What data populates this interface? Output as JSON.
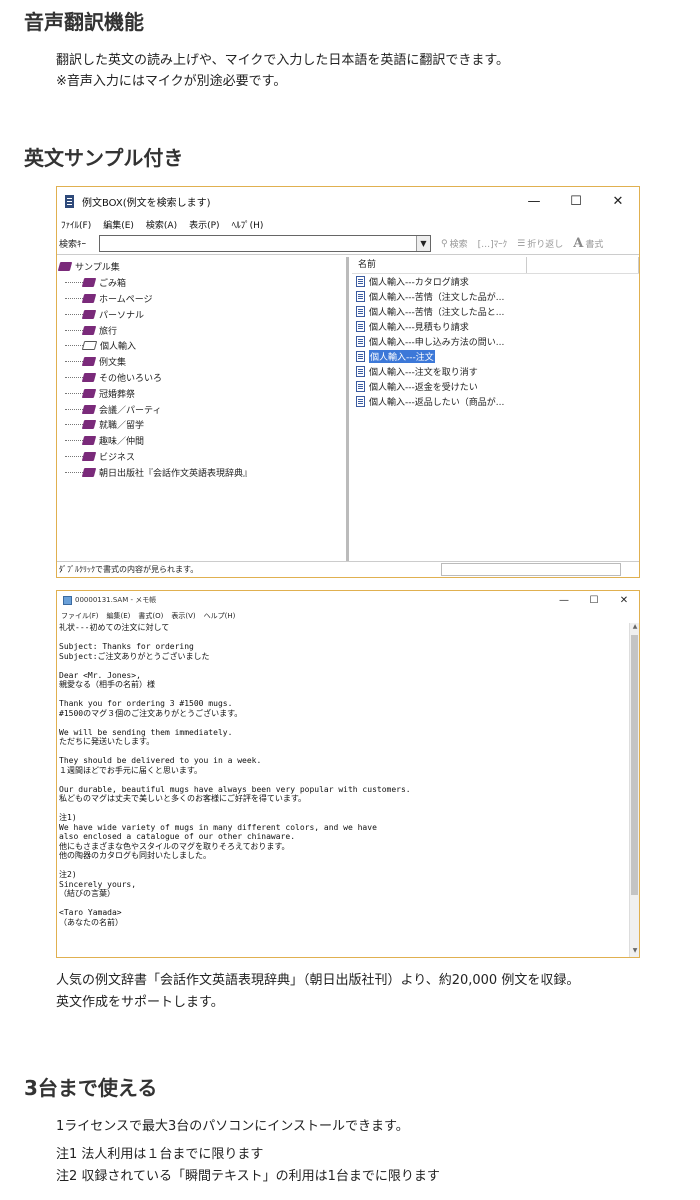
{
  "section1": {
    "heading": "音声翻訳機能",
    "line1": "翻訳した英文の読み上げや、マイクで入力した日本語を英語に翻訳できます。",
    "line2": "※音声入力にはマイクが別途必要です。"
  },
  "section2": {
    "heading": "英文サンプル付き",
    "caption1": "人気の例文辞書「会話作文英語表現辞典」（朝日出版社刊）より、約20,000 例文を収録。",
    "caption2": "英文作成をサポートします。"
  },
  "window1": {
    "title": "例文BOX(例文を検索します)",
    "controls": {
      "minimize": "—",
      "maximize": "☐",
      "close": "✕"
    },
    "menu": [
      "ﾌｧｲﾙ(F)",
      "編集(E)",
      "検索(A)",
      "表示(P)",
      "ﾍﾙﾌﾟ(H)"
    ],
    "search_label": "検索ｷｰ",
    "search_value": "",
    "toolbar": {
      "search": "検索",
      "mark": "[…]ﾏｰｸ",
      "wrap": "折り返し",
      "style": "書式",
      "style_glyph": "A"
    },
    "tree_root": "サンプル集",
    "tree_items": [
      "ごみ箱",
      "ホームページ",
      "パーソナル",
      "旅行",
      "個人輸入",
      "例文集",
      "その他いろいろ",
      "冠婚葬祭",
      "会議／パーティ",
      "就職／留学",
      "趣味／仲間",
      "ビジネス",
      "朝日出版社『会話作文英語表現辞典』"
    ],
    "list_header": "名前",
    "list_items": [
      "個人輸入---カタログ請求",
      "個人輸入---苦情（注文した品が...",
      "個人輸入---苦情（注文した品と...",
      "個人輸入---見積もり請求",
      "個人輸入---申し込み方法の問い...",
      "個人輸入---注文",
      "個人輸入---注文を取り消す",
      "個人輸入---返金を受けたい",
      "個人輸入---返品したい（商品が..."
    ],
    "selected_index": 5,
    "status": "ﾀﾞﾌﾞﾙｸﾘｯｸで書式の内容が見られます。"
  },
  "window2": {
    "title": "00000131.SAM - メモ帳",
    "controls": {
      "minimize": "—",
      "maximize": "☐",
      "close": "✕"
    },
    "menu": [
      "ファイル(F)",
      "編集(E)",
      "書式(O)",
      "表示(V)",
      "ヘルプ(H)"
    ],
    "scroll_up": "▲",
    "scroll_down": "▼",
    "text": "礼状---初めての注文に対して\n\nSubject: Thanks for ordering\nSubject:ご注文ありがとうございました\n\nDear <Mr. Jones>,\n親愛なる（相手の名前）様\n\nThank you for ordering 3 #1500 mugs.\n#1500のマグ３個のご注文ありがとうございます。\n\nWe will be sending them immediately.\nただちに発送いたします。\n\nThey should be delivered to you in a week.\n１週間ほどでお手元に届くと思います。\n\nOur durable, beautiful mugs have always been very popular with customers.\n私どものマグは丈夫で美しいと多くのお客様にご好評を得ています。\n\n注1)\nWe have wide variety of mugs in many different colors, and we have\nalso enclosed a catalogue of our other chinaware.\n他にもさまざまな色やスタイルのマグを取りそろえております。\n他の陶器のカタログも同封いたしました。\n\n注2)\nSincerely yours,\n（結びの言葉）\n\n<Taro Yamada>\n（あなたの名前）"
  },
  "section3": {
    "heading": "3台まで使える",
    "line1": "1ライセンスで最大3台のパソコンにインストールできます。",
    "note1": "注1 法人利用は１台までに限ります",
    "note2": "注2 収録されている「瞬間テキスト」の利用は1台までに限ります"
  }
}
